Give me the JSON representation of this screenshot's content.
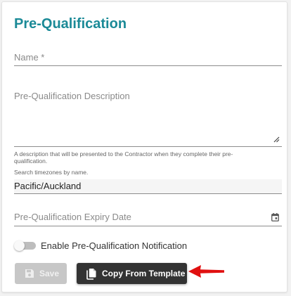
{
  "form": {
    "title": "Pre-Qualification",
    "name_label": "Name *",
    "description_label": "Pre-Qualification Description",
    "description_help_line1": "A description that will be presented to the Contractor when they complete their pre-",
    "description_help_line2": "qualification.",
    "timezone_hint": "Search timezones by name.",
    "timezone_value": "Pacific/Auckland",
    "expiry_label": "Pre-Qualification Expiry Date",
    "notification_toggle_label": "Enable Pre-Qualification Notification",
    "notification_enabled": false,
    "save_label": "Save",
    "copy_label": "Copy From Template"
  },
  "colors": {
    "title": "#1b8a97",
    "copy_button": "#333333",
    "save_button_disabled": "#c7c7c7",
    "annotation_arrow": "#e01010"
  },
  "icons": [
    "resize-handle-icon",
    "calendar-icon",
    "save-icon",
    "copy-icon",
    "annotation-arrow"
  ]
}
